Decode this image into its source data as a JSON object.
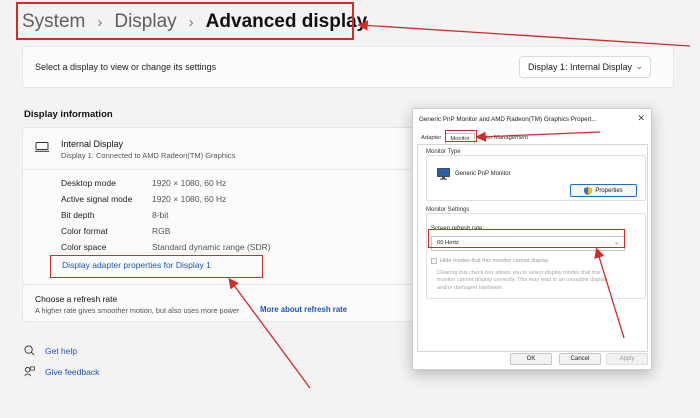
{
  "breadcrumb": {
    "root": "System",
    "mid": "Display",
    "current": "Advanced display"
  },
  "select_display": {
    "label": "Select a display to view or change its settings",
    "value": "Display 1: Internal Display"
  },
  "display_info": {
    "section_title": "Display information",
    "title": "Internal Display",
    "subtitle": "Display 1: Connected to AMD Radeon(TM) Graphics",
    "properties": [
      {
        "label": "Desktop mode",
        "value": "1920 × 1080, 60 Hz"
      },
      {
        "label": "Active signal mode",
        "value": "1920 × 1080, 60 Hz"
      },
      {
        "label": "Bit depth",
        "value": "8-bit"
      },
      {
        "label": "Color format",
        "value": "RGB"
      },
      {
        "label": "Color space",
        "value": "Standard dynamic range (SDR)"
      }
    ],
    "adapter_link": "Display adapter properties for Display 1"
  },
  "refresh_rate": {
    "title": "Choose a refresh rate",
    "subtitle": "A higher rate gives smoother motion, but also uses more power",
    "link": "More about refresh rate"
  },
  "help": {
    "get_help": "Get help",
    "feedback": "Give feedback"
  },
  "dialog": {
    "title": "Generic PnP Monitor and AMD Radeon(TM) Graphics Propert...",
    "tabs": [
      "Adapter",
      "Monitor",
      "Color Management"
    ],
    "monitor_type_label": "Monitor Type",
    "monitor_name": "Generic PnP Monitor",
    "properties_button": "Properties",
    "monitor_settings_label": "Monitor Settings",
    "refresh_label": "Screen refresh rate:",
    "refresh_value": "60 Hertz",
    "hide_modes": "Hide modes that this monitor cannot display",
    "hide_desc": "Clearing this check box allows you to select display modes that this monitor cannot display correctly. This may lead to an unusable display and/or damaged hardware.",
    "ok": "OK",
    "cancel": "Cancel",
    "apply": "Apply"
  },
  "colors": {
    "annotation_red": "#d52a2a",
    "link_blue": "#1a56b8"
  }
}
